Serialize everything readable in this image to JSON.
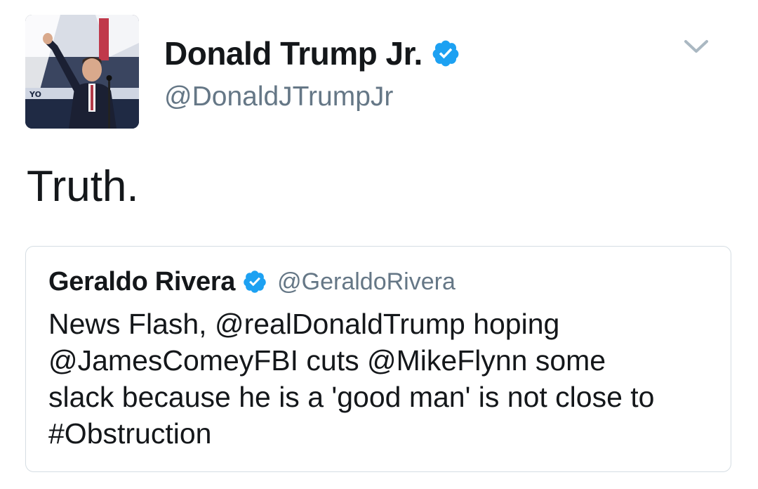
{
  "tweet": {
    "author": {
      "display_name": "Donald Trump Jr.",
      "handle": "@DonaldJTrumpJr",
      "verified": true,
      "avatar_icon": "profile-photo"
    },
    "menu_icon": "chevron-down-icon",
    "text": "Truth.",
    "quoted_tweet": {
      "display_name": "Geraldo Rivera",
      "handle": "@GeraldoRivera",
      "verified": true,
      "lines": [
        "News Flash, @realDonaldTrump hoping",
        "@JamesComeyFBI cuts @MikeFlynn some",
        "slack because he is a 'good man' is not close to",
        "#Obstruction"
      ]
    }
  },
  "colors": {
    "verified_blue": "#1da1f2",
    "text_primary": "#14171a",
    "text_secondary": "#657786",
    "border": "#d5dde3"
  }
}
